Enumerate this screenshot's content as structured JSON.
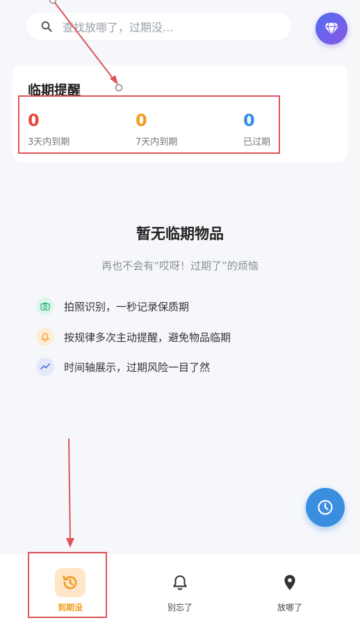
{
  "search": {
    "placeholder": "查找放哪了，过期没..."
  },
  "reminder": {
    "title": "临期提醒",
    "stats": [
      {
        "value": "0",
        "label": "3天内到期",
        "color": "#e8453c"
      },
      {
        "value": "0",
        "label": "7天内到期",
        "color": "#f29a1e"
      },
      {
        "value": "0",
        "label": "已过期",
        "color": "#2f8ee6"
      }
    ]
  },
  "empty": {
    "title": "暂无临期物品",
    "subtitle": "再也不会有“哎呀！过期了”的烦恼"
  },
  "features": [
    {
      "icon": "camera-icon",
      "text": "拍照识别，一秒记录保质期",
      "color": "#2bb57a",
      "bg": "#dff5ec"
    },
    {
      "icon": "bell-icon",
      "text": "按规律多次主动提醒，避免物品临期",
      "color": "#f29a1e",
      "bg": "#fdecd6"
    },
    {
      "icon": "trend-icon",
      "text": "时间轴展示，过期风险一目了然",
      "color": "#4b6fd6",
      "bg": "#e3e8fa"
    }
  ],
  "nav": [
    {
      "label": "到期没",
      "icon": "history-icon",
      "active": true
    },
    {
      "label": "别忘了",
      "icon": "bell-icon",
      "active": false
    },
    {
      "label": "放哪了",
      "icon": "location-pin-icon",
      "active": false
    }
  ],
  "colors": {
    "accent": "#f29a1e",
    "fab": "#3a8ee0",
    "annotation": "#e0525a"
  }
}
